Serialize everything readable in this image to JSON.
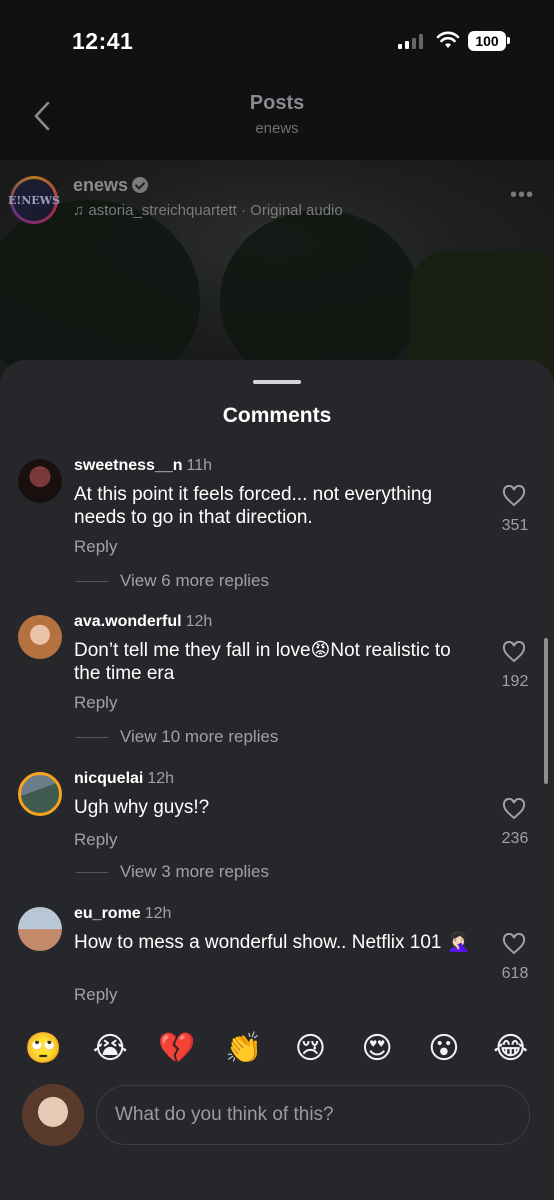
{
  "status_bar": {
    "time": "12:41",
    "battery": "100"
  },
  "nav": {
    "title": "Posts",
    "subtitle": "enews"
  },
  "post": {
    "avatar_text": "E!NEWS",
    "username": "enews",
    "audio": "astoria_streichquartett · Original audio",
    "more": "•••"
  },
  "comments_sheet": {
    "title": "Comments",
    "comments": [
      {
        "username": "sweetness__n",
        "time": "11h",
        "text": "At this point it feels forced... not everything needs to go in that direction.",
        "reply": "Reply",
        "more_replies": "View 6 more replies",
        "likes": "351"
      },
      {
        "username": "ava.wonderful",
        "time": "12h",
        "text": "Don’t tell me they fall in love😡Not realistic to the time era",
        "reply": "Reply",
        "more_replies": "View 10 more replies",
        "likes": "192"
      },
      {
        "username": "nicquelai",
        "time": "12h",
        "text": "Ugh why guys!?",
        "reply": "Reply",
        "more_replies": "View 3 more replies",
        "likes": "236"
      },
      {
        "username": "eu_rome",
        "time": "12h",
        "text": "How to mess a wonderful show.. Netflix 101 🤦🏻‍♀️",
        "reply": "Reply",
        "likes": "618"
      }
    ]
  },
  "emoji_bar": [
    "🙄",
    "😭",
    "💔",
    "👏",
    "😢",
    "😍",
    "😮",
    "😂"
  ],
  "composer": {
    "placeholder": "What do you think of this?"
  },
  "colors": {
    "sheet_bg": "#26272b",
    "text": "#ffffff",
    "muted": "#a0a0a5"
  }
}
